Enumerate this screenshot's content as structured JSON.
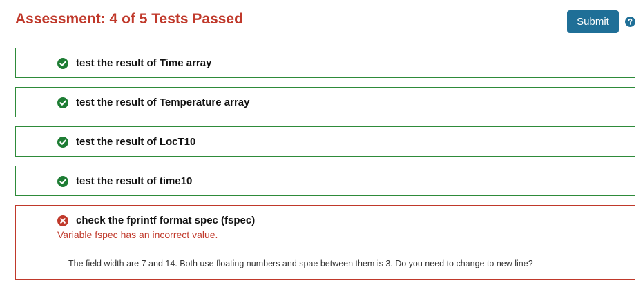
{
  "assessment": {
    "title": "Assessment: 4 of 5 Tests Passed",
    "submit_label": "Submit",
    "help_icon": "question-circle-icon"
  },
  "tests": [
    {
      "label": "test the result of Time array",
      "status": "passed",
      "icon": "check-circle-icon"
    },
    {
      "label": "test the result of Temperature array",
      "status": "passed",
      "icon": "check-circle-icon"
    },
    {
      "label": "test the result of LocT10",
      "status": "passed",
      "icon": "check-circle-icon"
    },
    {
      "label": "test the result of time10",
      "status": "passed",
      "icon": "check-circle-icon"
    },
    {
      "label": "check the fprintf format spec (fspec)",
      "status": "failed",
      "icon": "x-circle-icon",
      "message": "Variable fspec has an incorrect value.",
      "feedback": "The field width are 7 and 14. Both use floating numbers and spae between them is 3. Do you need to change to new line?"
    }
  ],
  "colors": {
    "title": "#c0392b",
    "pass": "#1e7d34",
    "fail": "#c0392b",
    "button": "#1f6f97",
    "help": "#1f6f97"
  }
}
